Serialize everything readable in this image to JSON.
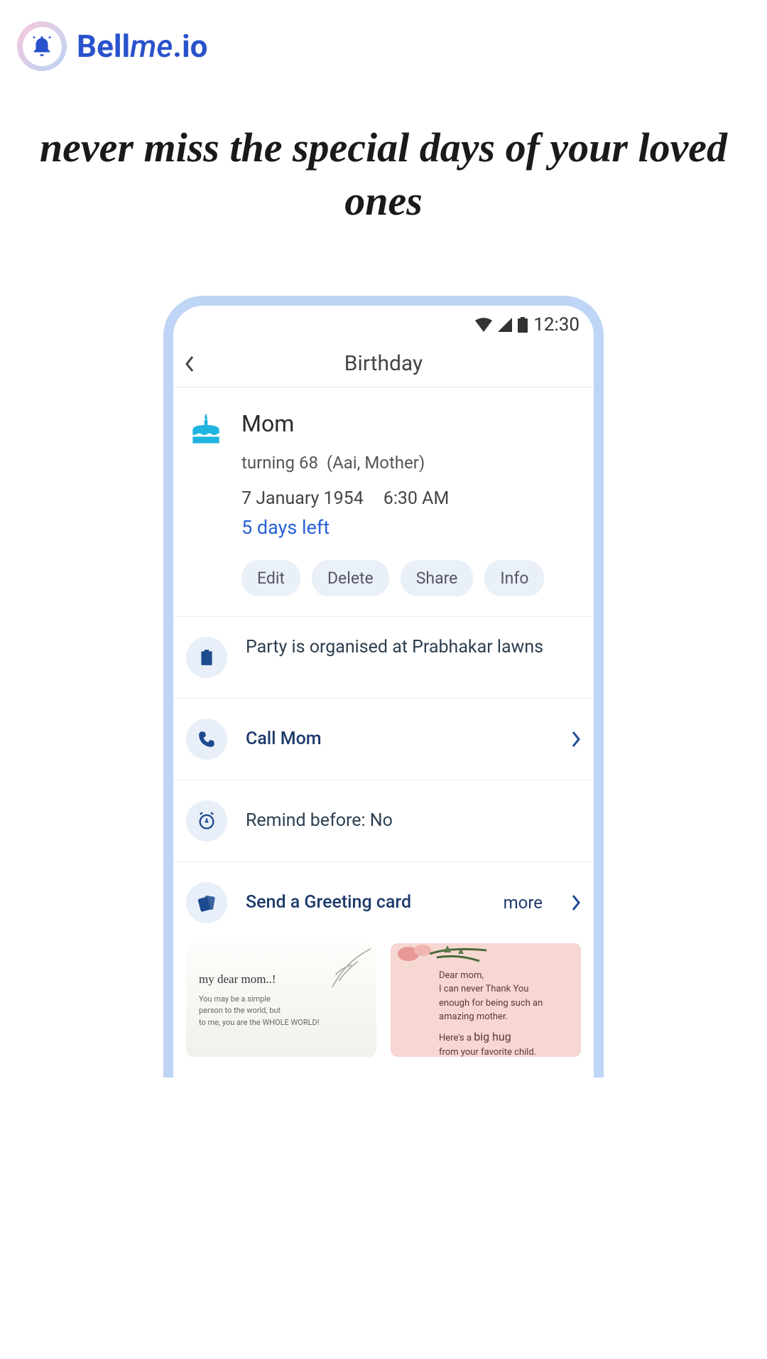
{
  "logo": {
    "brand_a": "Bell",
    "brand_b": "me",
    "brand_c": ".io"
  },
  "tagline": "never miss the special days of your loved ones",
  "status": {
    "time": "12:30"
  },
  "appbar": {
    "title": "Birthday"
  },
  "person": {
    "name": "Mom",
    "turning": "turning 68",
    "alias": "(Aai, Mother)",
    "date": "7 January 1954",
    "time": "6:30 AM",
    "days_left": "5 days left"
  },
  "actions": {
    "edit": "Edit",
    "delete": "Delete",
    "share": "Share",
    "info": "Info"
  },
  "note": "Party is organised at Prabhakar lawns",
  "call": "Call Mom",
  "remind": "Remind before: No",
  "greeting": {
    "title": "Send a Greeting card",
    "more": "more"
  },
  "card1": {
    "title": "my dear mom..!",
    "l1": "You may be a simple",
    "l2": "person to the world, but",
    "l3": "to me, you are the WHOLE WORLD!"
  },
  "card2": {
    "l1": "Dear mom,",
    "l2": "I can never Thank You",
    "l3": "enough for being such an",
    "l4": "amazing mother.",
    "l5a": "Here's a ",
    "l5b": "big hug",
    "l6": "from your favorite child."
  }
}
